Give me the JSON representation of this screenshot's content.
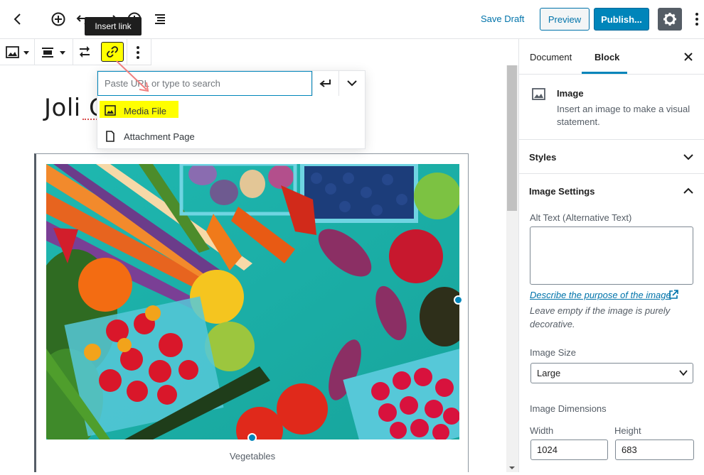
{
  "tooltip": {
    "text": "Insert link"
  },
  "header": {
    "save_draft": "Save Draft",
    "preview": "Preview",
    "publish": "Publish..."
  },
  "post": {
    "title": "Joli C",
    "image_caption": "Vegetables"
  },
  "link_popover": {
    "placeholder": "Paste URL or type to search",
    "suggestions": [
      {
        "label": "Media File",
        "icon": "image-icon"
      },
      {
        "label": "Attachment Page",
        "icon": "page-icon"
      }
    ]
  },
  "sidebar": {
    "tabs": [
      {
        "label": "Document"
      },
      {
        "label": "Block"
      }
    ],
    "active_tab": "Block",
    "block_card": {
      "title": "Image",
      "description": "Insert an image to make a visual statement."
    },
    "panels": {
      "styles": "Styles",
      "image_settings": "Image Settings"
    },
    "alt_text_label": "Alt Text (Alternative Text)",
    "alt_help_link": "Describe the purpose of the image",
    "alt_help_text": "Leave empty if the image is purely decorative.",
    "image_size_label": "Image Size",
    "image_size_value": "Large",
    "dimensions_label": "Image Dimensions",
    "width_label": "Width",
    "height_label": "Height",
    "width_value": "1024",
    "height_value": "683"
  },
  "colors": {
    "accent": "#0085ba",
    "highlight": "#ffff00"
  }
}
